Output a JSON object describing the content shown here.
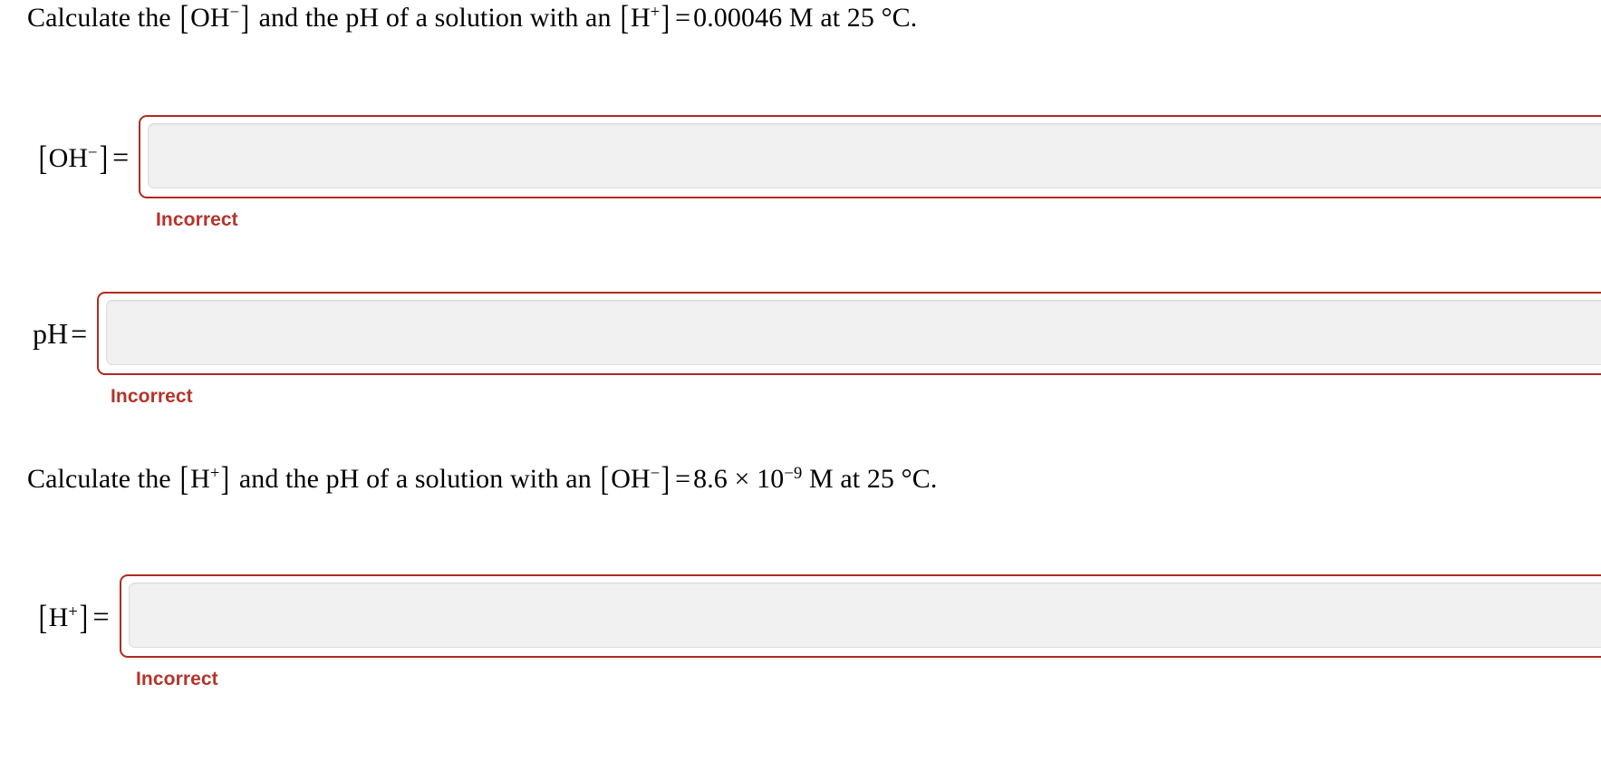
{
  "page": {
    "background_color": "#ffffff",
    "text_color": "#000000",
    "error_color": "#b5342a",
    "field_border_color": "#b02a20",
    "field_fill_color": "#f1f1f1"
  },
  "questions": [
    {
      "id": "question-1",
      "text_parts": {
        "lead": "Calculate the",
        "species_find_open": "[",
        "species_find": "OH",
        "species_find_charge": "−",
        "species_find_close": "]",
        "middle": "and the pH of a solution with an",
        "species_given_open": "[",
        "species_given": "H",
        "species_given_charge": "+",
        "species_given_close": "]",
        "equals": "=",
        "value": "0.00046",
        "unit": "M",
        "at": "at",
        "temperature": "25 °C."
      },
      "full_text": "Calculate the [OH−] and the pH of a solution with an [H+] = 0.00046 M at 25 °C."
    },
    {
      "id": "question-2",
      "text_parts": {
        "lead": "Calculate the",
        "species_find_open": "[",
        "species_find": "H",
        "species_find_charge": "+",
        "species_find_close": "]",
        "middle": "and the pH of a solution with an",
        "species_given_open": "[",
        "species_given": "OH",
        "species_given_charge": "−",
        "species_given_close": "]",
        "equals": "=",
        "value_mantissa": "8.6",
        "times": "×",
        "base": "10",
        "exponent": "−9",
        "unit": "M",
        "at": "at",
        "temperature": "25 °C."
      },
      "full_text": "Calculate the [H+] and the pH of a solution with an [OH−] = 8.6 × 10−9 M at 25 °C."
    }
  ],
  "answers": [
    {
      "id": "answer-oh",
      "label_open": "[",
      "label_species": "OH",
      "label_charge": "−",
      "label_close": "]",
      "label_equals": "=",
      "value": "",
      "placeholder": "",
      "feedback": "Incorrect",
      "state": "incorrect"
    },
    {
      "id": "answer-ph-1",
      "label_text": "pH",
      "label_equals": "=",
      "value": "",
      "placeholder": "",
      "feedback": "Incorrect",
      "state": "incorrect"
    },
    {
      "id": "answer-h",
      "label_open": "[",
      "label_species": "H",
      "label_charge": "+",
      "label_close": "]",
      "label_equals": "=",
      "value": "",
      "placeholder": "",
      "feedback": "Incorrect",
      "state": "incorrect"
    }
  ]
}
